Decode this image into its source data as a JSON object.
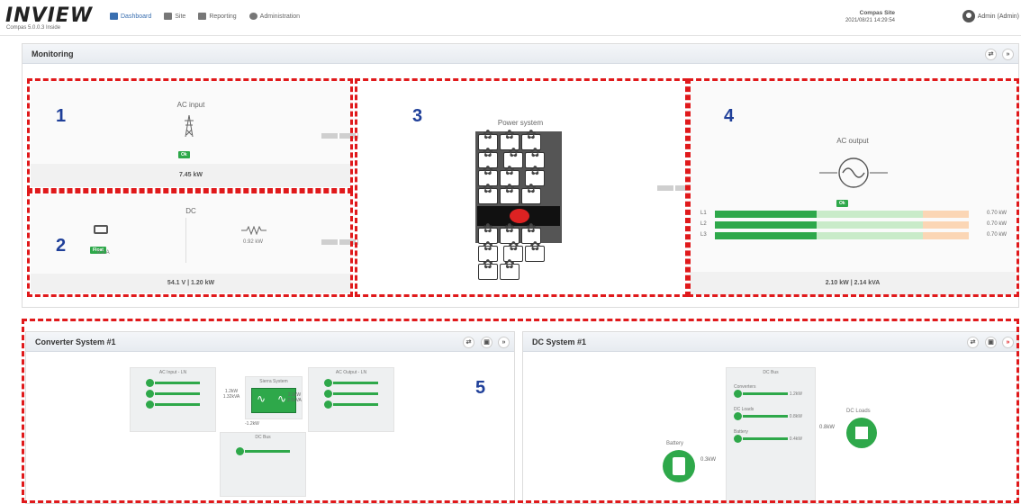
{
  "app": {
    "logo": "INVIEW",
    "version": "Compas 5.0.0.3 Inside"
  },
  "nav": [
    {
      "label": "Dashboard",
      "icon": "dashboard-icon",
      "active": true
    },
    {
      "label": "Site",
      "icon": "flag-icon"
    },
    {
      "label": "Reporting",
      "icon": "chart-icon"
    },
    {
      "label": "Administration",
      "icon": "gear-icon"
    }
  ],
  "site": {
    "name": "Compas Site",
    "timestamp": "2021/08/21 14:29:54"
  },
  "user": {
    "label": "Admin (Admin)"
  },
  "monitoring": {
    "title": "Monitoring",
    "ac_input": {
      "title": "AC input",
      "status": "Ok",
      "power": "7.45 kW"
    },
    "dc": {
      "title": "DC",
      "battery_status": "Float",
      "battery_current": "0.2 A",
      "load_power": "0.92 kW",
      "summary": "54.1 V | 1.20 kW"
    },
    "power_system": {
      "title": "Power system"
    },
    "ac_output": {
      "title": "AC output",
      "status": "Ok",
      "phases": [
        {
          "label": "L1",
          "value": "0.70 kW"
        },
        {
          "label": "L2",
          "value": "0.70 kW"
        },
        {
          "label": "L3",
          "value": "0.70 kW"
        }
      ],
      "summary": "2.10 kW | 2.14 kVA"
    }
  },
  "converter": {
    "title": "Converter System #1",
    "ac_input_title": "AC Input - LN",
    "sierra_title": "Sierra System",
    "ac_output_title": "AC Output - LN",
    "dc_bus_title": "DC Bus",
    "in_flow": "1.2kW",
    "in_flow2": "1.32kVA",
    "out_flow": "2.1kW",
    "out_flow2": "2.1kVA",
    "dc_flow": "-1.2kW"
  },
  "dc_system": {
    "title": "DC System #1",
    "bus_title": "DC Bus",
    "rows": [
      {
        "label": "Converters",
        "value": "1.2kW"
      },
      {
        "label": "DC Loads",
        "value": "0.8kW"
      },
      {
        "label": "Battery",
        "value": "0.4kW"
      }
    ],
    "battery_label": "Battery",
    "battery_flow": "0.3kW",
    "loads_label": "DC Loads",
    "loads_flow": "0.8kW"
  },
  "callouts": [
    "1",
    "2",
    "3",
    "4",
    "5"
  ],
  "colors": {
    "ok": "#2ea84a",
    "dash": "#e0191b",
    "bar_green": "#2ea84a",
    "bar_light": "#c9ebc9",
    "bar_orange": "#fbd6b5"
  }
}
